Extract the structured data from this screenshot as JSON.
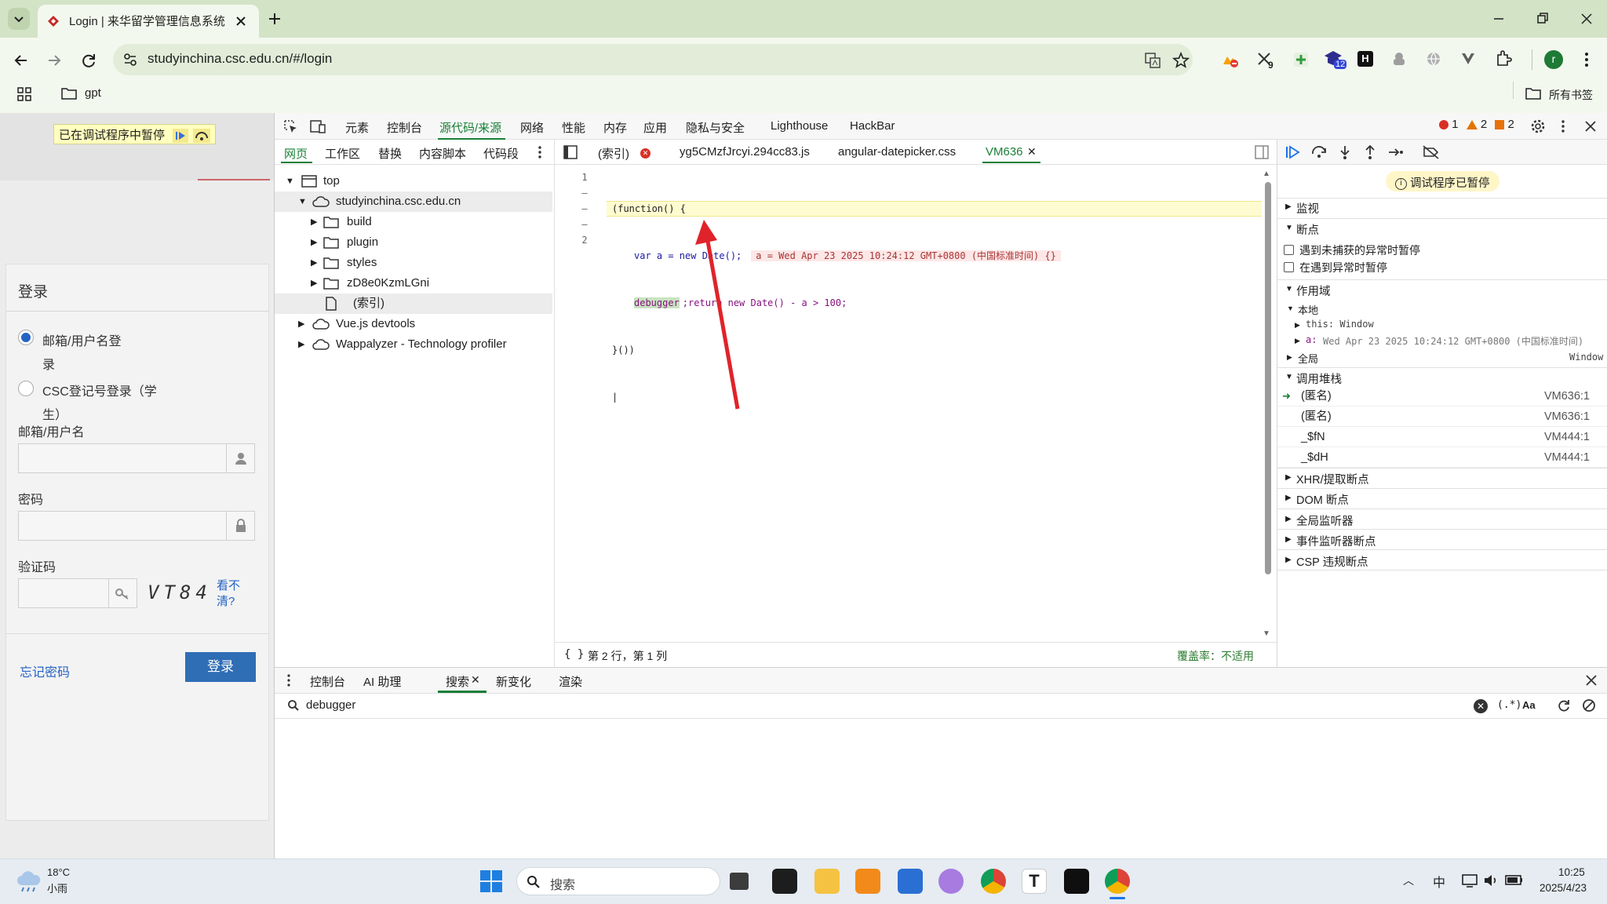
{
  "browser": {
    "tab_title": "Login | 来华留学管理信息系统",
    "url": "studyinchina.csc.edu.cn/#/login",
    "extension_badge": "9",
    "extension_count": "12",
    "profile_initial": "r",
    "bookmark_folder": "gpt",
    "all_bookmarks": "所有书签"
  },
  "page": {
    "paused_banner": "已在调试程序中暂停",
    "login_title": "登录",
    "radio_email": "邮箱/用户名登",
    "radio_email_2": "录",
    "radio_csc": "CSC登记号登录（学",
    "radio_csc_2": "生）",
    "label_user": "邮箱/用户名",
    "label_password": "密码",
    "label_captcha": "验证码",
    "captcha_text": "VT84",
    "captcha_refresh": "看不",
    "captcha_refresh_2": "清?",
    "forgot": "忘记密码",
    "login_button": "登录"
  },
  "devtools": {
    "main_tabs": [
      "元素",
      "控制台",
      "源代码/来源",
      "网络",
      "性能",
      "内存",
      "应用",
      "隐私与安全",
      "Lighthouse",
      "HackBar"
    ],
    "active_main_tab": "源代码/来源",
    "errors": "1",
    "warnings": "2",
    "issues": "2",
    "nav_tabs": [
      "网页",
      "工作区",
      "替换",
      "内容脚本",
      "代码段"
    ],
    "file_tabs": [
      "(索引)",
      "yg5CMzfJrcyi.294cc83.js",
      "angular-datepicker.css",
      "VM636"
    ],
    "tree": {
      "top": "top",
      "domain": "studyinchina.csc.edu.cn",
      "folders": [
        "build",
        "plugin",
        "styles",
        "zD8e0KzmLGni"
      ],
      "index_file": "(索引)",
      "vue": "Vue.js devtools",
      "wappalyzer": "Wappalyzer - Technology profiler"
    },
    "code": {
      "line_numbers": [
        "1",
        "–",
        "–",
        "–",
        "2"
      ],
      "line1": "(function() {",
      "line2_code": "var a = new Date();",
      "line2_inline": "a = Wed Apr 23 2025 10:24:12 GMT+0800 (中国标准时间) {}",
      "line3_keyword": "debugger",
      "line3_rest": ";return new Date() - a > 100;",
      "line4": "}())"
    },
    "status_position": "第 2 行，第 1 列",
    "coverage": "覆盖率：不适用",
    "paused_badge": "调试程序已暂停",
    "sections": {
      "watch": "监视",
      "breakpoints": "断点",
      "pause_uncaught": "遇到未捕获的异常时暂停",
      "pause_caught": "在遇到异常时暂停",
      "scope": "作用域",
      "local": "本地",
      "this_label": "this: Window",
      "a_label": "a:",
      "a_value": "Wed Apr 23 2025 10:24:12 GMT+0800 (中国标准时间)",
      "global": "全局",
      "global_value": "Window",
      "call_stack": "调用堆栈",
      "xhr": "XHR/提取断点",
      "dom": "DOM 断点",
      "global_listeners": "全局监听器",
      "event_listeners": "事件监听器断点",
      "csp": "CSP 违规断点"
    },
    "stack": [
      {
        "name": "(匿名)",
        "loc": "VM636:1"
      },
      {
        "name": "(匿名)",
        "loc": "VM636:1"
      },
      {
        "name": "_$fN",
        "loc": "VM444:1"
      },
      {
        "name": "_$dH",
        "loc": "VM444:1"
      }
    ],
    "drawer_tabs": [
      "控制台",
      "AI 助理",
      "搜索",
      "新变化",
      "渲染"
    ],
    "search_query": "debugger",
    "search_regex": "(.*)",
    "search_case": "Aa"
  },
  "taskbar": {
    "temp": "18°C",
    "weather": "小雨",
    "search_placeholder": "搜索",
    "ime": "中",
    "time": "10:25",
    "date": "2025/4/23"
  }
}
